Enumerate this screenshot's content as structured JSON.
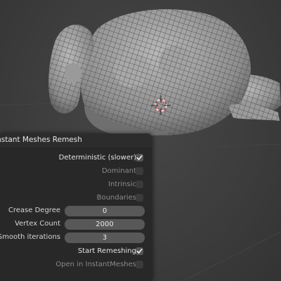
{
  "panel": {
    "title": "Instant Meshes Remesh",
    "options": [
      {
        "label": "Deterministic (slower)",
        "checked": true
      },
      {
        "label": "Dominant",
        "checked": false
      },
      {
        "label": "Intrinsic",
        "checked": false
      },
      {
        "label": "Boundaries",
        "checked": false
      }
    ],
    "fields": [
      {
        "label": "Crease Degree",
        "value": "0"
      },
      {
        "label": "Vertex Count",
        "value": "2000"
      },
      {
        "label": "Smooth iterations",
        "value": "3"
      }
    ],
    "start_remeshing": {
      "label": "Start Remeshing",
      "checked": true
    },
    "open_in_instantmeshes": {
      "label": "Open in InstantMeshes",
      "checked": false
    }
  },
  "icons": {
    "checkmark": "check-icon",
    "cursor": "3d-cursor-icon"
  }
}
